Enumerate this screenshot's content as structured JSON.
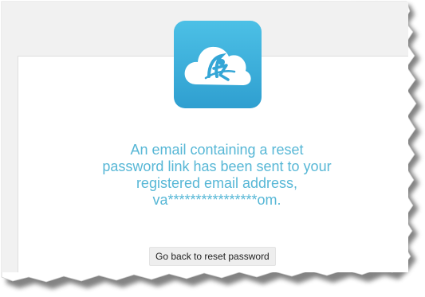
{
  "logo": {
    "icon": "cloud-person-icon",
    "color": "#34a6d6"
  },
  "message": {
    "line1": "An email containing a reset",
    "line2": "password link has been sent to your",
    "line3": "registered email address,",
    "line4": "va****************om."
  },
  "back_button": {
    "label": "Go back to reset password"
  },
  "colors": {
    "accent": "#57b7d6",
    "tile": "#34a6d6"
  }
}
